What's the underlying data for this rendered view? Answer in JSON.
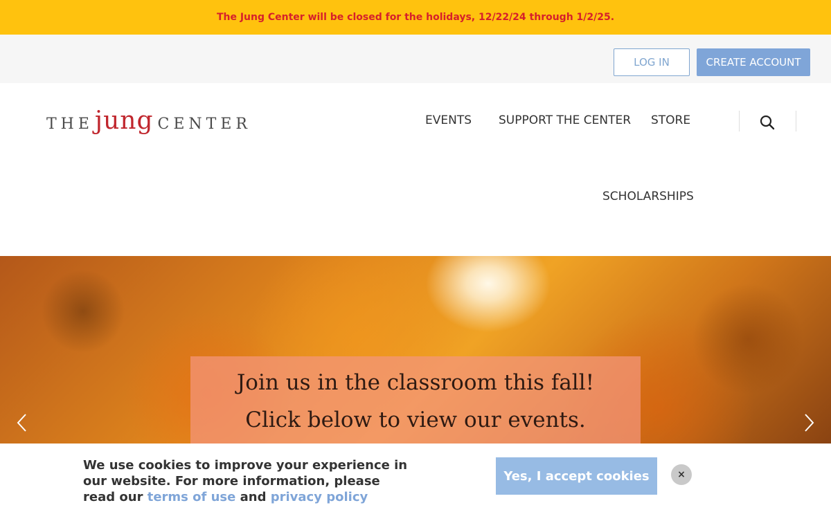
{
  "banner": {
    "text": "The Jung Center will be closed for the holidays, 12/22/24 through 1/2/25."
  },
  "account": {
    "login_label": "LOG IN",
    "create_label": "CREATE ACCOUNT"
  },
  "logo": {
    "part1": "THE",
    "part2": "jung",
    "part3": "CENTER"
  },
  "nav": {
    "events": "EVENTS",
    "support": "SUPPORT THE CENTER",
    "store": "STORE",
    "scholarships": "SCHOLARSHIPS",
    "search_icon": "search-icon"
  },
  "hero": {
    "line1": "Join us in the classroom this fall!",
    "line2": "Click below to view our events."
  },
  "cookie": {
    "text_before": "We use cookies to improve your experience in our website. For more information, please read our ",
    "terms_link": "terms of use",
    "and": " and ",
    "privacy_link": "privacy policy",
    "accept_label": "Yes, I accept cookies",
    "close_label": "×"
  },
  "colors": {
    "banner_bg": "#ffc20e",
    "banner_text": "#d6202b",
    "accent": "#7fa5d8",
    "logo_red": "#c0262d"
  }
}
